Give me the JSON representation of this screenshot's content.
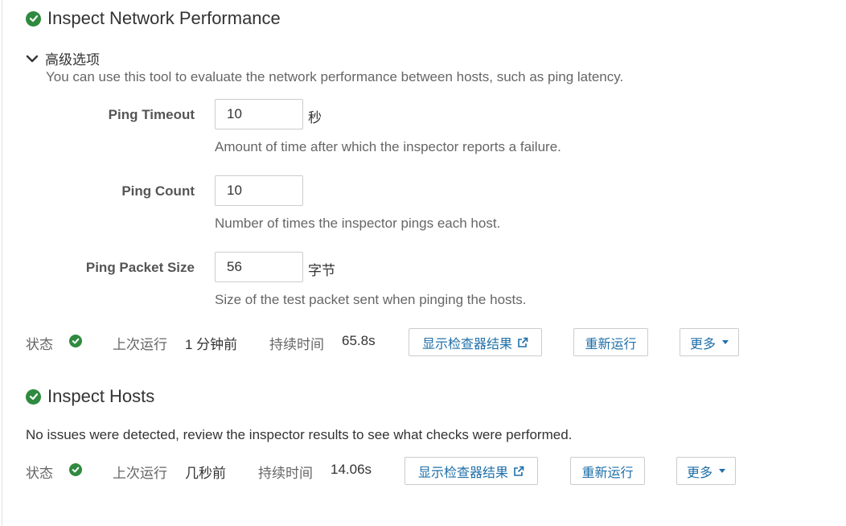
{
  "network": {
    "title": "Inspect Network Performance",
    "advanced_toggle": "高级选项",
    "description": "You can use this tool to evaluate the network performance between hosts, such as ping latency.",
    "fields": [
      {
        "label": "Ping Timeout",
        "value": "10",
        "unit": "秒",
        "help": "Amount of time after which the inspector reports a failure."
      },
      {
        "label": "Ping Count",
        "value": "10",
        "unit": "",
        "help": "Number of times the inspector pings each host."
      },
      {
        "label": "Ping Packet Size",
        "value": "56",
        "unit": "字节",
        "help": "Size of the test packet sent when pinging the hosts."
      }
    ],
    "status": {
      "status_label": "状态",
      "last_run_label": "上次运行",
      "last_run_value": "1 分钟前",
      "duration_label": "持续时间",
      "duration_value": "65.8s",
      "show_results": "显示检查器结果",
      "rerun": "重新运行",
      "more": "更多"
    }
  },
  "hosts": {
    "title": "Inspect Hosts",
    "message": "No issues were detected, review the inspector results to see what checks were performed.",
    "status": {
      "status_label": "状态",
      "last_run_label": "上次运行",
      "last_run_value": "几秒前",
      "duration_label": "持续时间",
      "duration_value": "14.06s",
      "show_results": "显示检查器结果",
      "rerun": "重新运行",
      "more": "更多"
    }
  },
  "colors": {
    "success": "#2f8a3f",
    "link": "#1f6fa8"
  }
}
